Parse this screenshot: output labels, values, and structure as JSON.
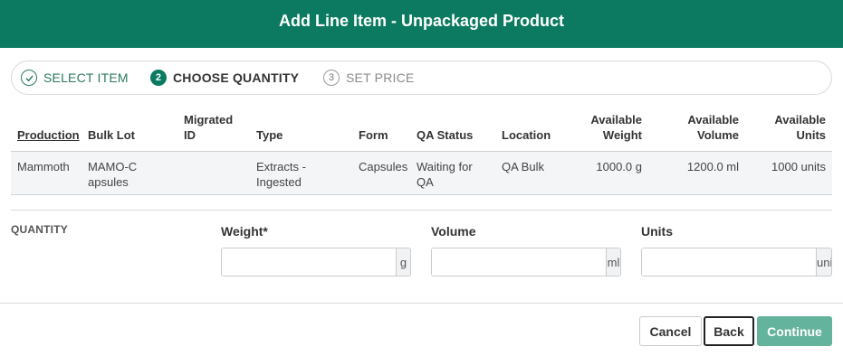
{
  "header": {
    "title": "Add Line Item - Unpackaged Product"
  },
  "stepper": {
    "steps": [
      {
        "number": "",
        "label": "SELECT ITEM",
        "state": "complete"
      },
      {
        "number": "2",
        "label": "CHOOSE QUANTITY",
        "state": "active"
      },
      {
        "number": "3",
        "label": "SET PRICE",
        "state": "upcoming"
      }
    ]
  },
  "table": {
    "columns": [
      {
        "label": "Production"
      },
      {
        "label": "Bulk Lot"
      },
      {
        "label": "Migrated ID"
      },
      {
        "label": "Type"
      },
      {
        "label": "Form"
      },
      {
        "label": "QA Status"
      },
      {
        "label": "Location"
      },
      {
        "label": "Available Weight"
      },
      {
        "label": "Available Volume"
      },
      {
        "label": "Available Units"
      }
    ],
    "rows": [
      {
        "production": "Mammoth",
        "bulk_lot": "MAMO-Capsules",
        "migrated_id": "",
        "type": "Extracts - Ingested",
        "form": "Capsules",
        "qa_status": "Waiting for QA",
        "location": "QA Bulk",
        "available_weight": "1000.0 g",
        "available_volume": "1200.0 ml",
        "available_units": "1000 units"
      }
    ]
  },
  "quantity": {
    "section_label": "QUANTITY",
    "weight": {
      "label": "Weight*",
      "value": "",
      "unit": "g"
    },
    "volume": {
      "label": "Volume",
      "value": "",
      "unit": "ml"
    },
    "units": {
      "label": "Units",
      "value": "",
      "unit": "units"
    }
  },
  "footer": {
    "cancel_label": "Cancel",
    "back_label": "Back",
    "continue_label": "Continue"
  },
  "colors": {
    "header_bg": "#0b7a60",
    "accent": "#0b7a60",
    "continue_disabled": "#64b39c"
  },
  "icons": {
    "step_complete": "check-circle-icon"
  }
}
